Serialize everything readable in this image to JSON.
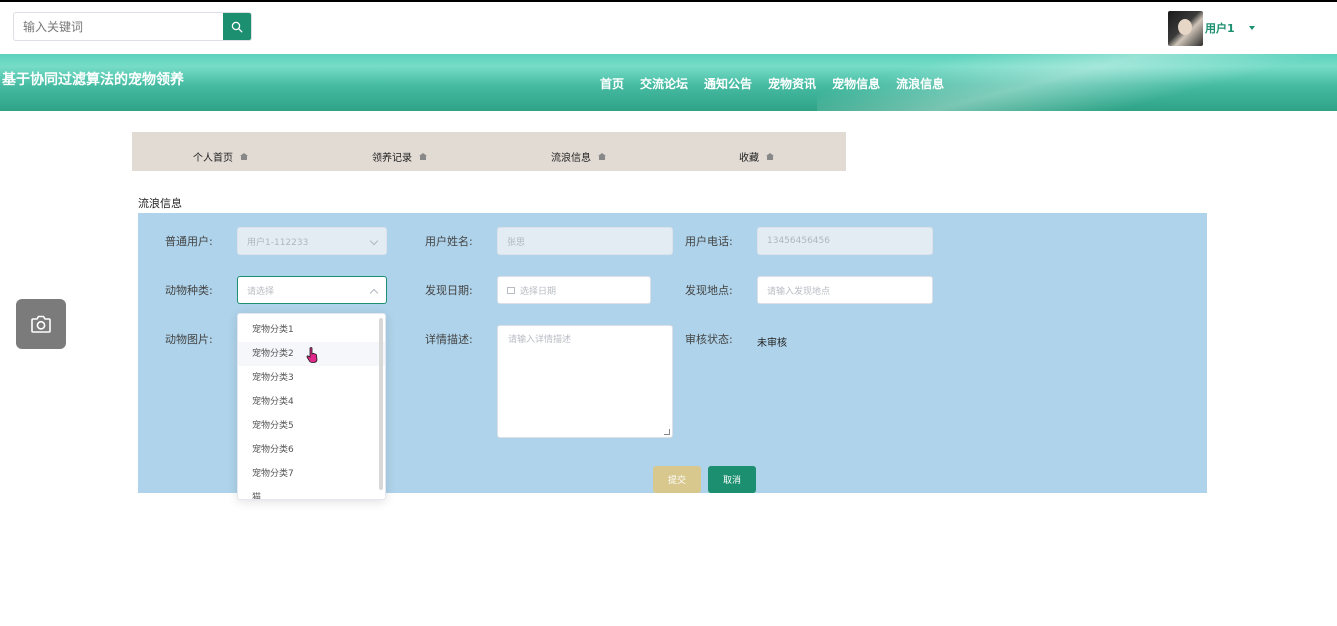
{
  "search": {
    "placeholder": "输入关键词"
  },
  "user": {
    "name": "用户1"
  },
  "site": {
    "title": "基于协同过滤算法的宠物领养"
  },
  "nav": [
    "首页",
    "交流论坛",
    "通知公告",
    "宠物资讯",
    "宠物信息",
    "流浪信息"
  ],
  "subnav": [
    "个人首页",
    "领养记录",
    "流浪信息",
    "收藏"
  ],
  "section_title": "流浪信息",
  "form": {
    "labels": {
      "user": "普通用户:",
      "username": "用户姓名:",
      "phone": "用户电话:",
      "animal_type": "动物种类:",
      "found_date": "发现日期:",
      "found_place": "发现地点:",
      "animal_image": "动物图片:",
      "detail": "详情描述:",
      "review_status": "审核状态:"
    },
    "values": {
      "user": "用户1-112233",
      "username": "张思",
      "phone": "13456456456",
      "review_status": "未审核"
    },
    "placeholders": {
      "animal_type": "请选择",
      "found_date": "选择日期",
      "found_place": "请输入发现地点",
      "detail": "请输入详情描述"
    },
    "buttons": {
      "submit": "提交",
      "cancel": "取消"
    }
  },
  "dropdown": {
    "options": [
      "宠物分类1",
      "宠物分类2",
      "宠物分类3",
      "宠物分类4",
      "宠物分类5",
      "宠物分类6",
      "宠物分类7",
      "猫"
    ],
    "hovered_index": 1
  },
  "colors": {
    "accent": "#1b8f6f",
    "header": "#4cc3aa",
    "panel": "#aed3ea",
    "submit": "#d8c88e"
  }
}
